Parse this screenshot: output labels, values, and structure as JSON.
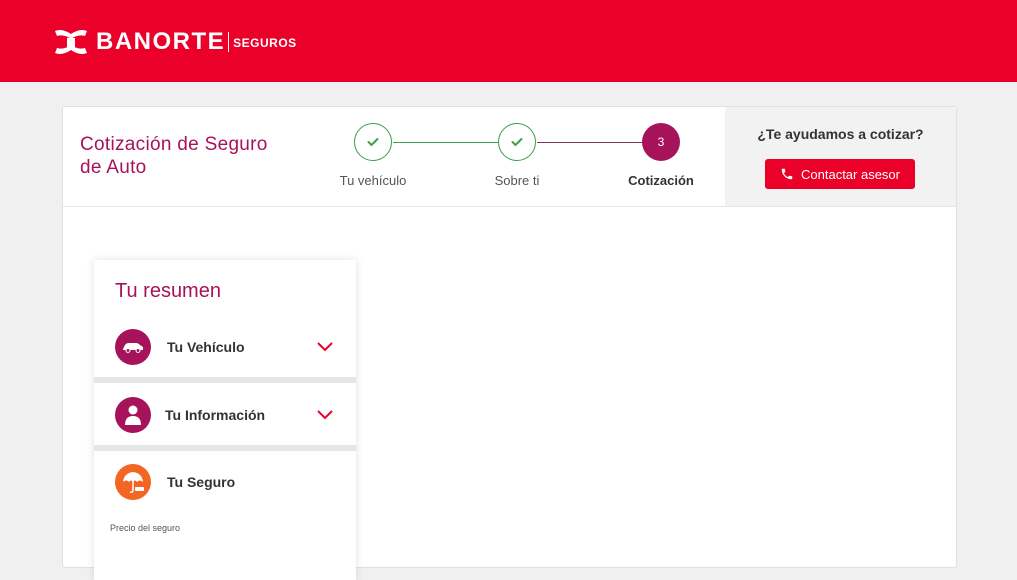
{
  "header": {
    "brand": "BANORTE",
    "sub_brand": "SEGUROS",
    "brand_color": "#eb0029"
  },
  "card": {
    "title": "Cotización de Seguro de Auto",
    "steps": [
      {
        "label": "Tu vehículo",
        "state": "done",
        "icon": "check-icon"
      },
      {
        "label": "Sobre ti",
        "state": "done",
        "icon": "check-icon"
      },
      {
        "label": "Cotización",
        "state": "active",
        "number": "3"
      }
    ],
    "help": {
      "question": "¿Te ayudamos a cotizar?",
      "button_label": "Contactar asesor",
      "button_icon": "phone-icon"
    }
  },
  "summary": {
    "title": "Tu resumen",
    "items": [
      {
        "label": "Tu Vehículo",
        "icon": "car-icon",
        "expandable": true
      },
      {
        "label": "Tu Información",
        "icon": "person-icon",
        "expandable": true
      },
      {
        "label": "Tu Seguro",
        "icon": "umbrella-car-icon",
        "expandable": false
      }
    ],
    "price_label": "Precio del seguro"
  },
  "colors": {
    "accent": "#a6135a",
    "success": "#3aa04a",
    "seguro_icon": "#f26522"
  }
}
